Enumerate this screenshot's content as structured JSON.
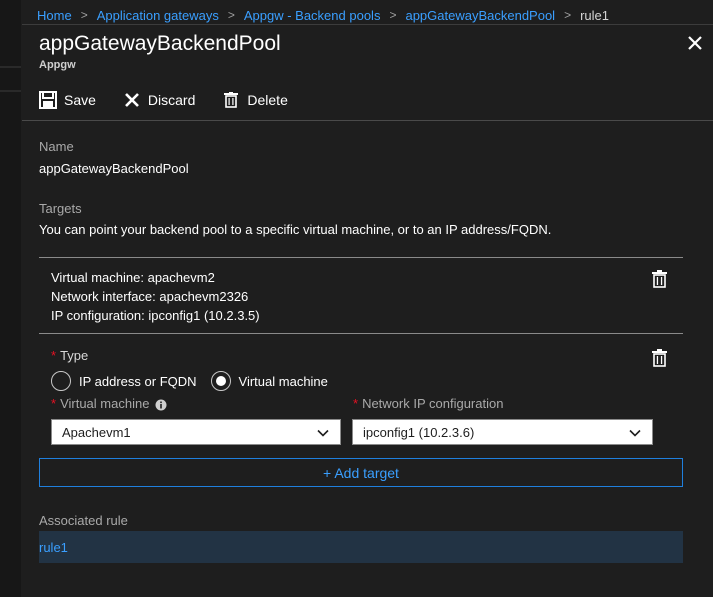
{
  "breadcrumb": {
    "items": [
      "Home",
      "Application gateways",
      "Appgw - Backend pools",
      "appGatewayBackendPool"
    ],
    "current": "rule1"
  },
  "blade": {
    "title": "appGatewayBackendPool",
    "subtitle": "Appgw"
  },
  "toolbar": {
    "save_label": "Save",
    "discard_label": "Discard",
    "delete_label": "Delete"
  },
  "name_field": {
    "label": "Name",
    "value": "appGatewayBackendPool"
  },
  "targets": {
    "label": "Targets",
    "description": "You can point your backend pool to a specific virtual machine, or to an IP address/FQDN.",
    "existing": [
      "Virtual machine: apachevm2",
      "Network interface: apachevm2326",
      "IP configuration: ipconfig1 (10.2.3.5)"
    ]
  },
  "new_target": {
    "type_label": "Type",
    "type_options": [
      "IP address or FQDN",
      "Virtual machine"
    ],
    "type_selected": "Virtual machine",
    "vm_label": "Virtual machine",
    "vm_value": "Apachevm1",
    "ipconfig_label": "Network IP configuration",
    "ipconfig_value": "ipconfig1 (10.2.3.6)",
    "required_mark": "*"
  },
  "add_target_label": "+ Add target",
  "associated_rule": {
    "label": "Associated rule",
    "value": "rule1"
  },
  "colors": {
    "background": "#1e1e1e",
    "link": "#3a9fff",
    "required": "#e81123",
    "accent_border": "#1f7fdd"
  },
  "icons": [
    "save-icon",
    "discard-x-icon",
    "trash-icon",
    "close-icon",
    "chevron-down-icon",
    "info-icon"
  ]
}
